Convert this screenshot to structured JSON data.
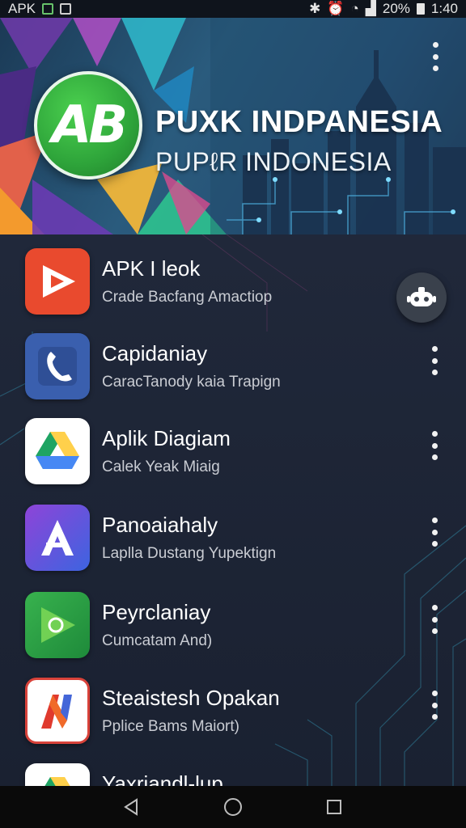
{
  "status_bar": {
    "carrier": "APK",
    "battery": "20%",
    "time": "1:40"
  },
  "header": {
    "logo_text": "AB",
    "title": "PUXK INDPANESIA",
    "subtitle": "PUPℓR INDONESIA",
    "menu_icon": "more-vert-icon"
  },
  "apps": [
    {
      "title": "APK I leok",
      "subtitle": "Crade Bacfang Amactiop",
      "icon": "play-icon",
      "color": "#e94a2e"
    },
    {
      "title": "Capidaniay",
      "subtitle": "CaracTanody kaia Trapign",
      "icon": "phone-icon",
      "color": "#3a5fae"
    },
    {
      "title": "Aplik Diagiam",
      "subtitle": "Calek Yeak Miaig",
      "icon": "drive-icon",
      "color": "#ffffff"
    },
    {
      "title": "Panoaiahaly",
      "subtitle": "Laplla Dustang Yupektign",
      "icon": "a-logo-icon",
      "color": "#6a4fd6"
    },
    {
      "title": "Peyrclaniay",
      "subtitle": "Cumcatam And)",
      "icon": "green-play-icon",
      "color": "#2f9f47"
    },
    {
      "title": "Steaistesh Opakan",
      "subtitle": "Pplice Bams Maiort)",
      "icon": "n-logo-icon",
      "color": "#ffffff"
    },
    {
      "title": "Yaxriandl-lup",
      "subtitle": "",
      "icon": "drive-icon",
      "color": "#ffffff"
    }
  ],
  "fab": {
    "icon": "robot-icon"
  },
  "nav": {
    "back_icon": "back-triangle-icon",
    "home_icon": "home-circle-icon",
    "recents_icon": "recents-square-icon"
  },
  "colors": {
    "background": "#1c2331",
    "header_accent": "#2a5b7d",
    "logo_green": "#2ea43a",
    "fab_bg": "#3a414c"
  }
}
